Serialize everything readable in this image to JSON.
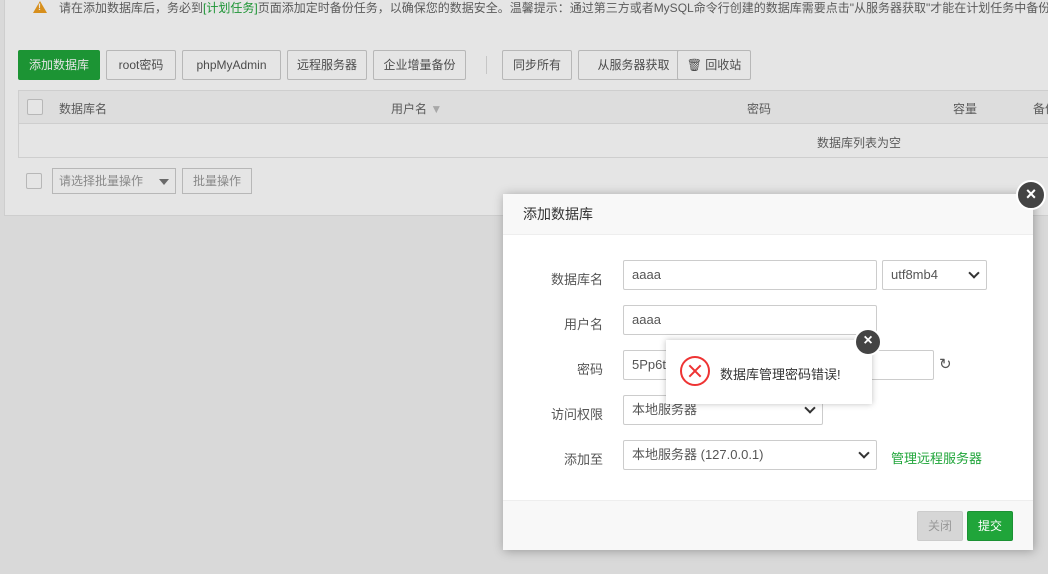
{
  "notice": {
    "before_link": "请在添加数据库后，务必到",
    "link_text": "[计划任务]",
    "after_link": "页面添加定时备份任务，以确保您的数据安全。温馨提示：通过第三方或者MySQL命令行创建的数据库需要点击\"从服务器获取\"才能在计划任务中备份"
  },
  "toolbar": {
    "add_db": "添加数据库",
    "root_pwd": "root密码",
    "phpmyadmin": "phpMyAdmin",
    "remote_server": "远程服务器",
    "incremental_backup": "企业增量备份",
    "sync_all": "同步所有",
    "fetch_from_server": "从服务器获取",
    "recycle_bin": "回收站"
  },
  "table": {
    "headers": [
      "数据库名",
      "用户名",
      "密码",
      "容量",
      "备份"
    ],
    "empty_text": "数据库列表为空"
  },
  "batch": {
    "placeholder": "请选择批量操作",
    "button": "批量操作"
  },
  "dialog": {
    "title": "添加数据库",
    "labels": {
      "db_name": "数据库名",
      "username": "用户名",
      "password": "密码",
      "access": "访问权限",
      "add_to": "添加至"
    },
    "values": {
      "db_name": "aaaa",
      "charset": "utf8mb4",
      "username": "aaaa",
      "password": "5Pp6t",
      "access": "本地服务器",
      "add_to": "本地服务器 (127.0.0.1)"
    },
    "manage_link": "管理远程服务器",
    "cancel": "关闭",
    "submit": "提交"
  },
  "toast": {
    "message": "数据库管理密码错误!"
  },
  "colors": {
    "accent": "#20a53a",
    "error": "#ee3333",
    "warning": "#f0a020"
  }
}
